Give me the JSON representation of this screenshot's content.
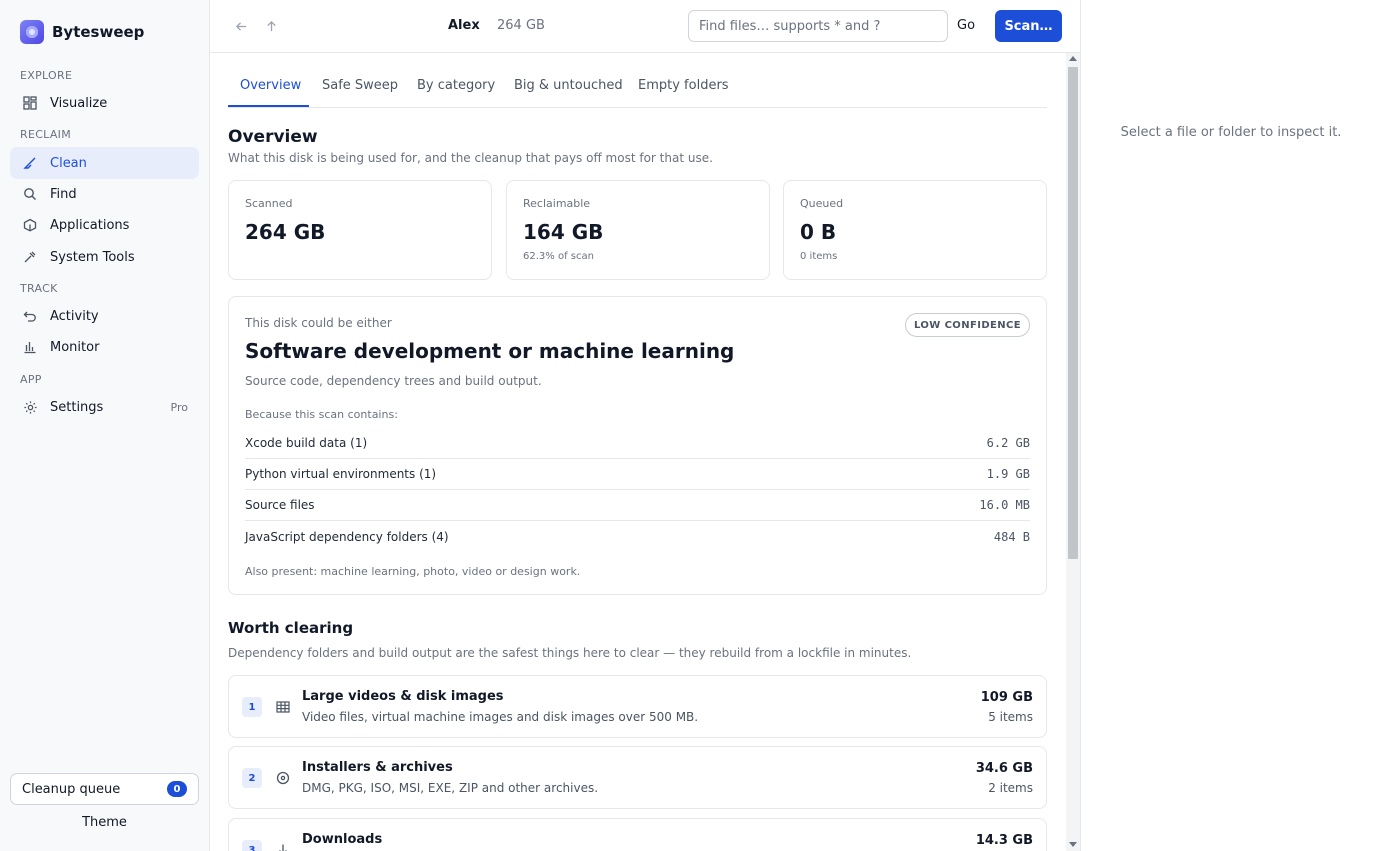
{
  "app": {
    "name": "Bytesweep"
  },
  "sidebar": {
    "sections": [
      {
        "label": "EXPLORE",
        "items": [
          {
            "label": "Visualize",
            "icon": "grid-icon"
          }
        ]
      },
      {
        "label": "RECLAIM",
        "items": [
          {
            "label": "Clean",
            "icon": "broom-icon",
            "active": true
          },
          {
            "label": "Find",
            "icon": "search-icon"
          },
          {
            "label": "Applications",
            "icon": "cube-icon"
          },
          {
            "label": "System Tools",
            "icon": "wrench-icon"
          }
        ]
      },
      {
        "label": "TRACK",
        "items": [
          {
            "label": "Activity",
            "icon": "undo-icon"
          },
          {
            "label": "Monitor",
            "icon": "bar-chart-icon"
          }
        ]
      },
      {
        "label": "APP",
        "items": [
          {
            "label": "Settings",
            "icon": "gear-icon",
            "badge": "Pro"
          }
        ]
      }
    ],
    "queue": {
      "label": "Cleanup queue",
      "count": "0"
    },
    "theme_label": "Theme"
  },
  "topbar": {
    "user": "Alex",
    "disk_size": "264 GB",
    "search_placeholder": "Find files… supports * and ?",
    "go_label": "Go",
    "scan_label": "Scan…"
  },
  "tabs": [
    {
      "label": "Overview",
      "active": true
    },
    {
      "label": "Safe Sweep"
    },
    {
      "label": "By category"
    },
    {
      "label": "Big & untouched"
    },
    {
      "label": "Empty folders"
    }
  ],
  "overview": {
    "title": "Overview",
    "subtitle": "What this disk is being used for, and the cleanup that pays off most for that use.",
    "stats": [
      {
        "label": "Scanned",
        "value": "264 GB",
        "note": ""
      },
      {
        "label": "Reclaimable",
        "value": "164 GB",
        "note": "62.3% of scan"
      },
      {
        "label": "Queued",
        "value": "0 B",
        "note": "0 items"
      }
    ]
  },
  "profile": {
    "eyebrow": "This disk could be either",
    "title": "Software development or machine learning",
    "badge": "LOW CONFIDENCE",
    "description": "Source code, dependency trees and build output.",
    "because_label": "Because this scan contains:",
    "evidence": [
      {
        "label": "Xcode build data (1)",
        "size": "6.2 GB"
      },
      {
        "label": "Python virtual environments (1)",
        "size": "1.9 GB"
      },
      {
        "label": "Source files",
        "size": "16.0 MB"
      },
      {
        "label": "JavaScript dependency folders (4)",
        "size": "484 B"
      }
    ],
    "also_present": "Also present: machine learning, photo, video or design work."
  },
  "worth_clearing": {
    "title": "Worth clearing",
    "subtitle": "Dependency folders and build output are the safest things here to clear — they rebuild from a lockfile in minutes.",
    "items": [
      {
        "rank": "1",
        "icon": "table-icon",
        "name": "Large videos & disk images",
        "description": "Video files, virtual machine images and disk images over 500 MB.",
        "size": "109 GB",
        "count": "5 items"
      },
      {
        "rank": "2",
        "icon": "disc-icon",
        "name": "Installers & archives",
        "description": "DMG, PKG, ISO, MSI, EXE, ZIP and other archives.",
        "size": "34.6 GB",
        "count": "2 items"
      },
      {
        "rank": "3",
        "icon": "download-icon",
        "name": "Downloads",
        "description": "",
        "size": "14.3 GB",
        "count": ""
      }
    ]
  },
  "inspector": {
    "empty_message": "Select a file or folder to inspect it."
  }
}
